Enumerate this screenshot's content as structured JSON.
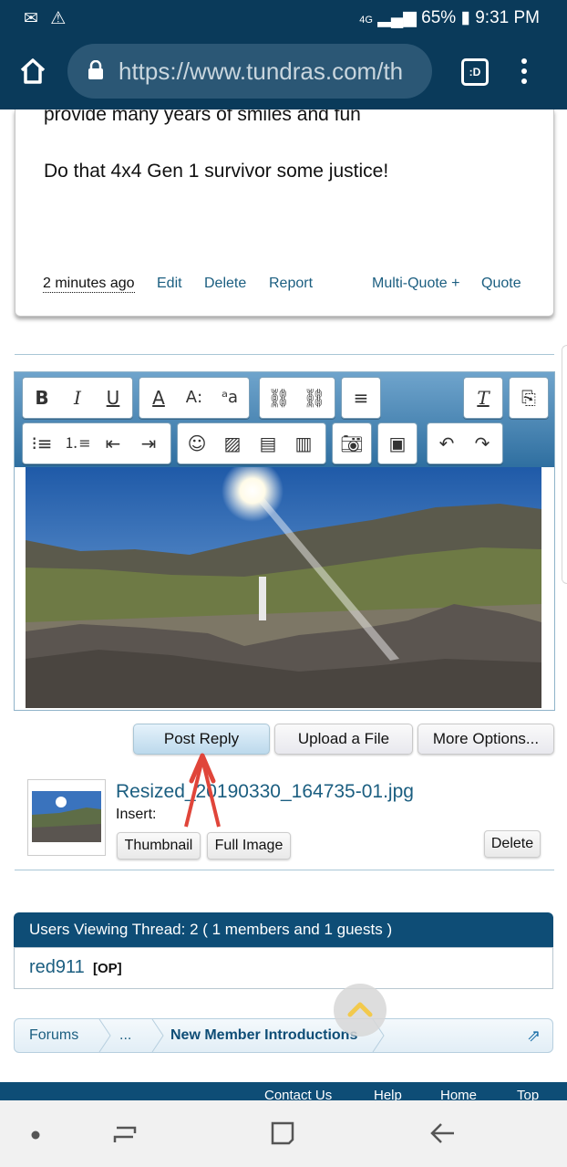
{
  "status_bar": {
    "battery": "65%",
    "time": "9:31 PM",
    "network": "4G"
  },
  "browser": {
    "url": "https://www.tundras.com/th",
    "tab_label": ":D"
  },
  "post": {
    "line1": "provide many years of smiles and fun",
    "line2": "Do that 4x4 Gen 1 survivor some justice!",
    "time_ago": "2 minutes ago",
    "actions": {
      "edit": "Edit",
      "delete": "Delete",
      "report": "Report",
      "multi_quote": "Multi-Quote +",
      "quote": "Quote"
    }
  },
  "editor": {
    "toolbar_icons": [
      "bold-icon",
      "italic-icon",
      "underline-icon",
      "font-color-icon",
      "font-size-icon",
      "font-family-icon",
      "link-icon",
      "unlink-icon",
      "align-icon",
      "remove-format-icon",
      "paste-icon",
      "bullet-list-icon",
      "numbered-list-icon",
      "outdent-icon",
      "indent-icon",
      "smiley-icon",
      "image-icon",
      "media-icon",
      "code-icon",
      "camera-icon",
      "save-icon",
      "undo-icon",
      "redo-icon"
    ]
  },
  "buttons": {
    "post_reply": "Post Reply",
    "upload_file": "Upload a File",
    "more_options": "More Options..."
  },
  "attachment": {
    "filename": "Resized_20190330_164735-01.jpg",
    "insert_label": "Insert:",
    "thumbnail": "Thumbnail",
    "full_image": "Full Image",
    "delete": "Delete"
  },
  "viewing": {
    "header": "Users Viewing Thread: 2 ( 1 members and 1 guests )",
    "user": "red911",
    "user_badge": "[OP]"
  },
  "breadcrumb": {
    "forums": "Forums",
    "ellipsis": "...",
    "current": "New Member Introductions"
  },
  "footer": {
    "contact": "Contact Us",
    "help": "Help",
    "home": "Home",
    "top": "Top"
  },
  "colors": {
    "header_bg": "#0a3a5a",
    "link": "#1b5e80",
    "accent_red": "#e0453a"
  }
}
